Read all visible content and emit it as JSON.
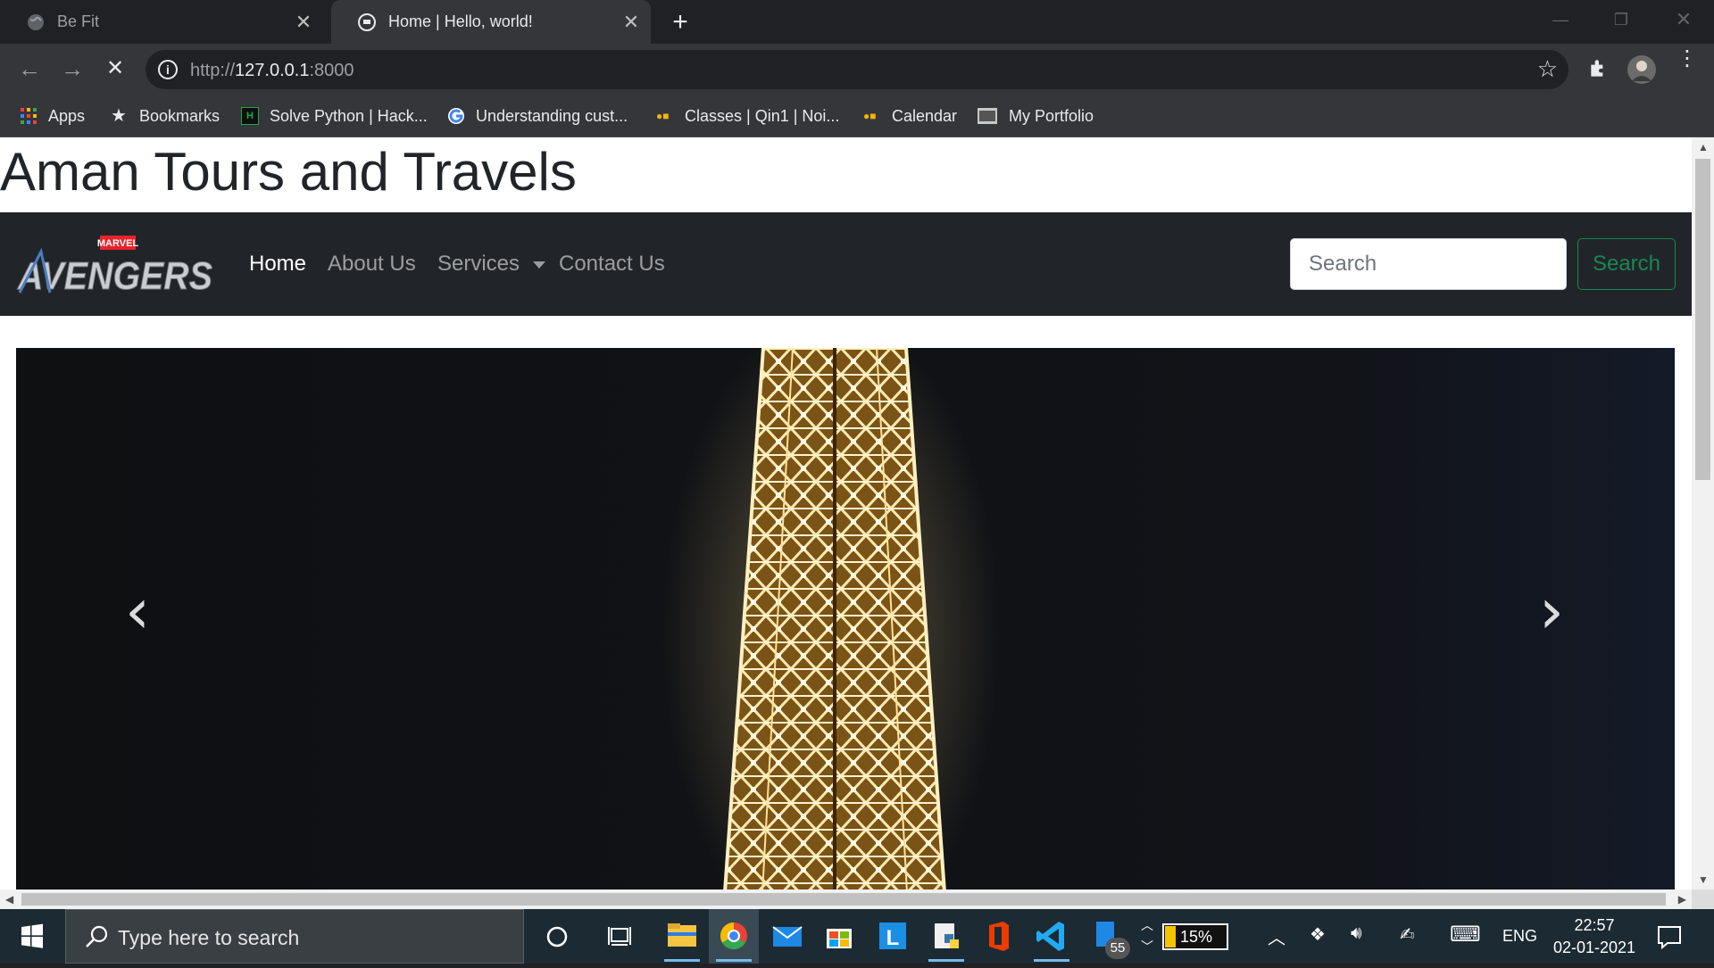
{
  "browser": {
    "tabs": [
      {
        "title": "Be Fit"
      },
      {
        "title": "Home | Hello, world!"
      }
    ],
    "url": {
      "scheme": "http://",
      "host": "127.0.0.1",
      "port": ":8000"
    },
    "bookmarks": [
      {
        "label": "Apps"
      },
      {
        "label": "Bookmarks"
      },
      {
        "label": "Solve Python | Hack..."
      },
      {
        "label": "Understanding cust..."
      },
      {
        "label": "Classes | Qin1 | Noi..."
      },
      {
        "label": "Calendar"
      },
      {
        "label": "My Portfolio"
      }
    ]
  },
  "site": {
    "title": "Aman Tours and Travels",
    "logo": {
      "top": "MARVEL",
      "main": "AVENGERS"
    },
    "nav": {
      "home": "Home",
      "about": "About Us",
      "services": "Services",
      "contact": "Contact Us"
    },
    "search": {
      "placeholder": "Search",
      "button": "Search"
    },
    "carousel": {
      "prev": "‹",
      "next": "›"
    }
  },
  "taskbar": {
    "search_placeholder": "Type here to search",
    "battery": "15%",
    "badge": "55",
    "lang": "ENG",
    "time": "22:57",
    "date": "02-01-2021"
  }
}
